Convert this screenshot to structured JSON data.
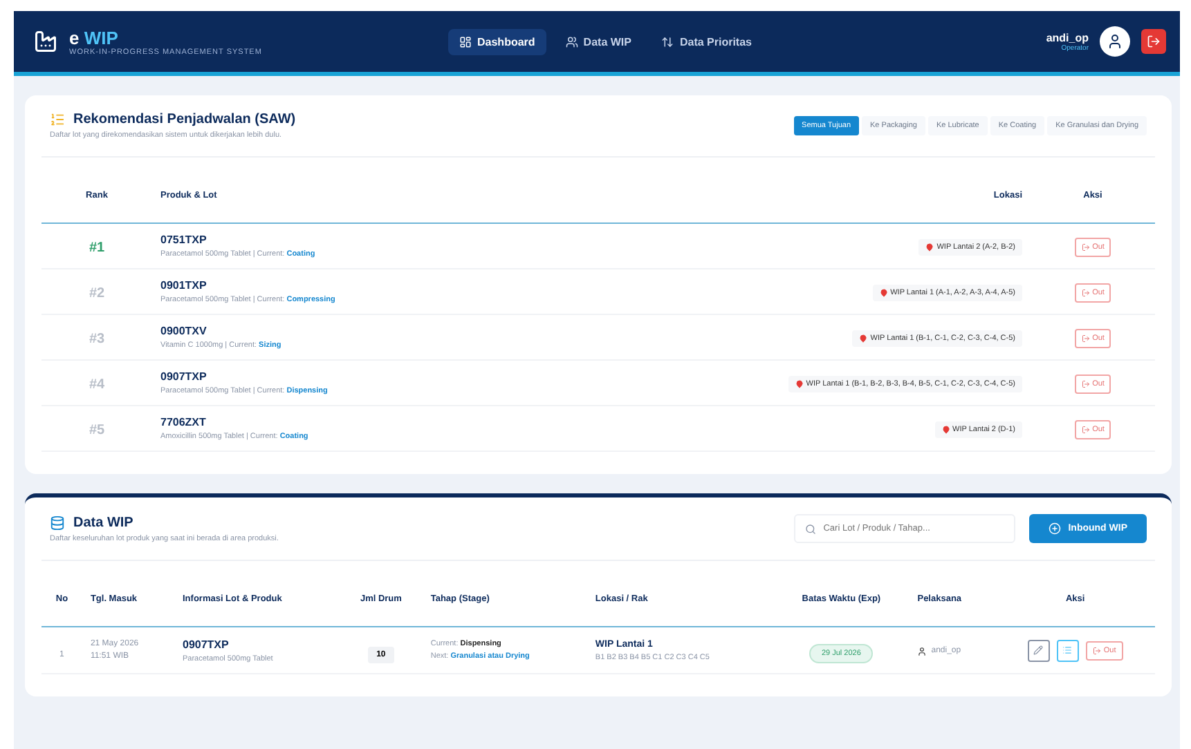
{
  "navbar": {
    "logo_prefix": "e",
    "logo_name": "WIP",
    "logo_subtitle": "WORK-IN-PROGRESS MANAGEMENT SYSTEM",
    "nav_items": [
      {
        "label": "Dashboard",
        "kind": "dashboard",
        "selected": true
      },
      {
        "label": "Data WIP",
        "kind": "users",
        "selected": false
      },
      {
        "label": "Data Prioritas",
        "kind": "sort",
        "selected": false
      }
    ],
    "user": {
      "name": "andi_op",
      "role": "Operator"
    }
  },
  "recommendation": {
    "title": "Rekomendasi Penjadwalan (SAW)",
    "subtitle": "Daftar lot yang direkomendasikan sistem untuk dikerjakan lebih dulu.",
    "filters": [
      {
        "label": "Semua Tujuan",
        "selected": true
      },
      {
        "label": "Ke Packaging",
        "selected": false
      },
      {
        "label": "Ke Lubricate",
        "selected": false
      },
      {
        "label": "Ke Coating",
        "selected": false
      },
      {
        "label": "Ke Granulasi dan Drying",
        "selected": false
      }
    ],
    "columns": [
      "Rank",
      "Produk & Lot",
      "Lokasi",
      "Aksi"
    ],
    "rows": [
      {
        "rank": "#1",
        "top": true,
        "lot": "0751TXP",
        "product": "Paracetamol 500mg Tablet | Current:",
        "stage": "Coating",
        "location": "WIP Lantai 2 (A-2, B-2)",
        "action": "Out"
      },
      {
        "rank": "#2",
        "top": false,
        "lot": "0901TXP",
        "product": "Paracetamol 500mg Tablet | Current:",
        "stage": "Compressing",
        "location": "WIP Lantai 1 (A-1, A-2, A-3, A-4, A-5)",
        "action": "Out"
      },
      {
        "rank": "#3",
        "top": false,
        "lot": "0900TXV",
        "product": "Vitamin C 1000mg | Current:",
        "stage": "Sizing",
        "location": "WIP Lantai 1 (B-1, C-1, C-2, C-3, C-4, C-5)",
        "action": "Out"
      },
      {
        "rank": "#4",
        "top": false,
        "lot": "0907TXP",
        "product": "Paracetamol 500mg Tablet | Current:",
        "stage": "Dispensing",
        "location": "WIP Lantai 1 (B-1, B-2, B-3, B-4, B-5, C-1, C-2, C-3, C-4, C-5)",
        "action": "Out"
      },
      {
        "rank": "#5",
        "top": false,
        "lot": "7706ZXT",
        "product": "Amoxicillin 500mg Tablet | Current:",
        "stage": "Coating",
        "location": "WIP Lantai 2 (D-1)",
        "action": "Out"
      }
    ]
  },
  "wip": {
    "title": "Data WIP",
    "subtitle": "Daftar keseluruhan lot produk yang saat ini berada di area produksi.",
    "search_placeholder": "Cari Lot / Produk / Tahap...",
    "inbound_button": "Inbound WIP",
    "columns": [
      "No",
      "Tgl. Masuk",
      "Informasi Lot & Produk",
      "Jml Drum",
      "Tahap (Stage)",
      "Lokasi / Rak",
      "Batas Waktu (Exp)",
      "Pelaksana",
      "Aksi"
    ],
    "rows": [
      {
        "no": "1",
        "date": "21 May 2026",
        "time": "11:51 WIB",
        "lot": "0907TXP",
        "product": "Paracetamol 500mg Tablet",
        "drums": "10",
        "current_label": "Current:",
        "current": "Dispensing",
        "next_label": "Next:",
        "next": "Granulasi atau Drying",
        "location": "WIP Lantai 1",
        "racks": "B1 B2 B3 B4 B5 C1 C2 C3 C4 C5",
        "expiry": "29 Jul 2026",
        "operator": "andi_op",
        "action": "Out"
      }
    ]
  }
}
